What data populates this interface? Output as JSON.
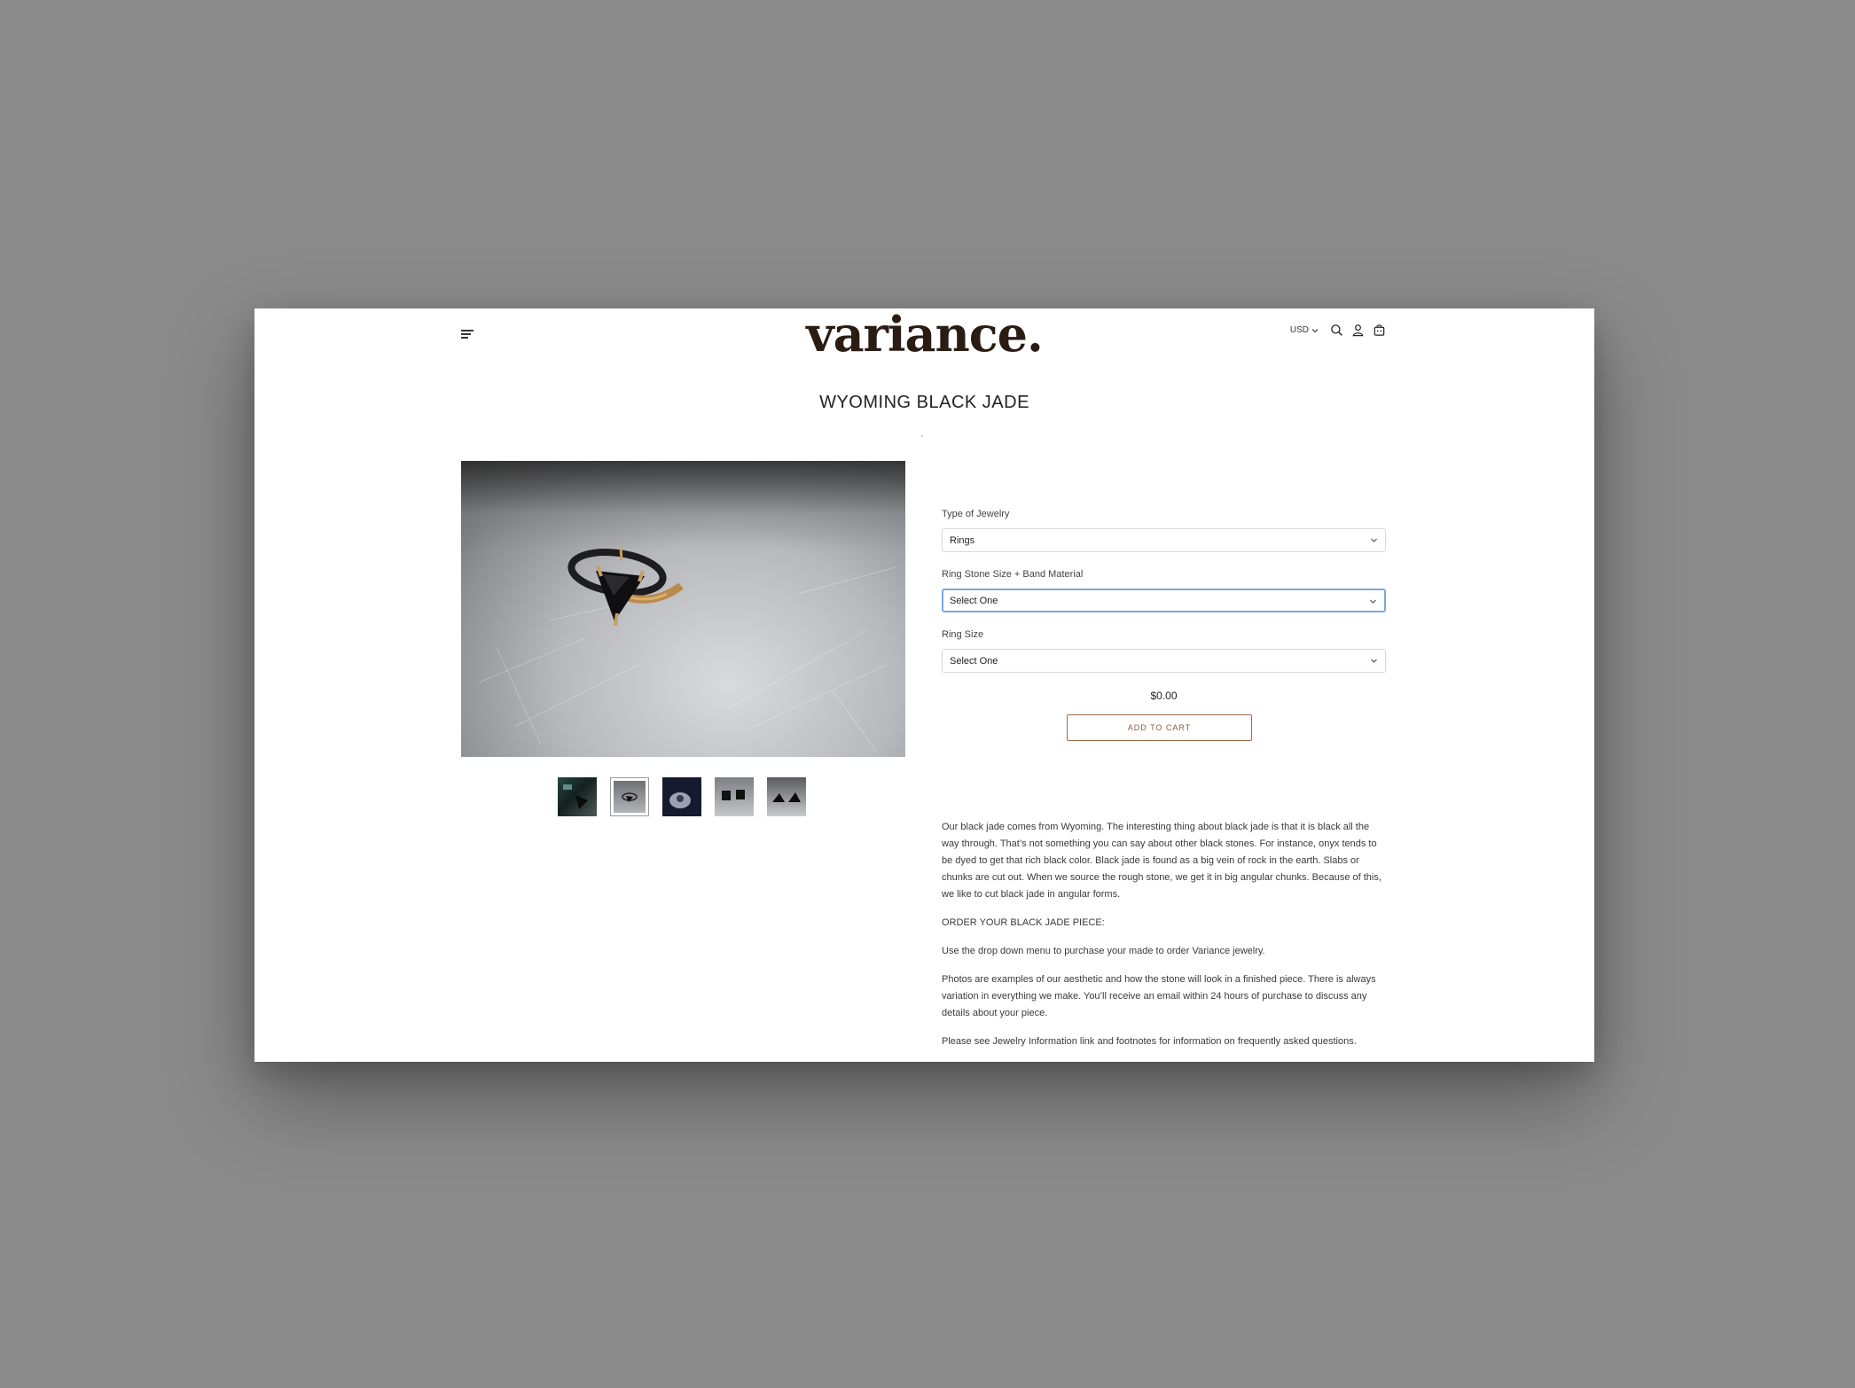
{
  "header": {
    "logo": "variance.",
    "currency": "USD",
    "icons": [
      "menu-icon",
      "search-icon",
      "account-icon",
      "cart-icon"
    ]
  },
  "product": {
    "title": "WYOMING BLACK JADE",
    "price": "$0.00",
    "add_to_cart": "ADD TO CART"
  },
  "options": [
    {
      "label": "Type of Jewelry",
      "value": "Rings"
    },
    {
      "label": "Ring Stone Size + Band Material",
      "value": "Select One"
    },
    {
      "label": "Ring Size",
      "value": "Select One"
    }
  ],
  "description": {
    "paragraphs": [
      "Our black jade comes from Wyoming. The interesting thing about black jade is that it is black all the way through. That’s not something you can say about other black stones. For instance, onyx tends to be dyed to get that rich black color. Black jade is found as a big vein of rock in the earth. Slabs or chunks are cut out. When we source the rough stone, we get it in big angular chunks. Because of this, we like to cut black jade in angular forms.",
      "ORDER YOUR BLACK JADE PIECE:",
      "Use the drop down menu to purchase your made to order Variance jewelry.",
      "Photos are examples of our aesthetic and how the stone will look in a finished piece. There is always variation in everything we make. You’ll receive an email within 24 hours of purchase to discuss any details about your piece.",
      "Please see Jewelry Information link and footnotes for information on frequently asked questions."
    ]
  },
  "colors": {
    "accent": "#9c6a4e",
    "focus_border": "#7ea7e0",
    "logo": "#2a1c13",
    "backdrop": "#8b8b8b"
  }
}
